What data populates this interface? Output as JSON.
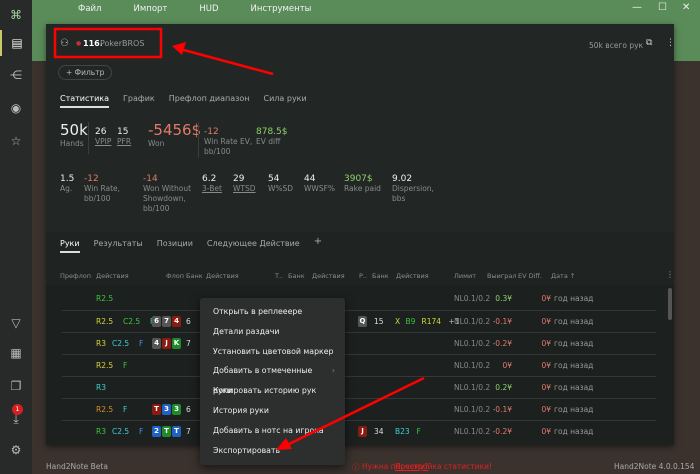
{
  "app": {
    "name": "Hand2Note Beta",
    "version": "Hand2Note 4.0.0.154"
  },
  "menu": [
    "Файл",
    "Импорт",
    "HUD",
    "Инструменты"
  ],
  "player": {
    "rank": "116.",
    "name": "PokerBROS",
    "total_hands": "50k всего рук"
  },
  "filter_label": "+ Фильтр",
  "stat_tabs": [
    "Статистика",
    "График",
    "Префлоп диапазон",
    "Сила руки"
  ],
  "stats_row1": [
    {
      "value": "50k",
      "label": "Hands"
    },
    {
      "value": "26",
      "label": "VPIP"
    },
    {
      "value": "15",
      "label": "PFR"
    },
    {
      "value": "-5456$",
      "label": "Won"
    },
    {
      "value": "-12",
      "label": "Win Rate EV, bb/100"
    },
    {
      "value": "878.5$",
      "label": "EV diff"
    }
  ],
  "stats_row2": [
    {
      "value": "1.5",
      "label": "Ag."
    },
    {
      "value": "-12",
      "label": "Win Rate, bb/100"
    },
    {
      "value": "-14",
      "label": "Won Without Showdown, bb/100"
    },
    {
      "value": "6.2",
      "label": "3-Bet"
    },
    {
      "value": "29",
      "label": "WTSD"
    },
    {
      "value": "54",
      "label": "W%SD"
    },
    {
      "value": "44",
      "label": "WWSF%"
    },
    {
      "value": "3907$",
      "label": "Rake paid"
    },
    {
      "value": "9.02",
      "label": "Dispersion, bbs"
    }
  ],
  "hand_tabs": [
    "Руки",
    "Результаты",
    "Позиции",
    "Следующее Действие",
    "+"
  ],
  "columns": [
    "Префлоп",
    "Действия",
    "Флоп",
    "Банк",
    "Действия",
    "Т..",
    "Банк",
    "Действия",
    "Р..",
    "Банк",
    "Действия",
    "Лимит",
    "Выиграл",
    "EV Diff.",
    "Дата ↑"
  ],
  "rows": [
    {
      "pre": [
        [
          "R2.5",
          "#3ec43e"
        ]
      ],
      "flop": [],
      "fpot": "",
      "river": "",
      "rpot": "",
      "ract": [],
      "limit": "NL0.1/0.2",
      "won": "0.3¥",
      "wonc": "#8fd16a",
      "ev": "0¥",
      "date": "год назад"
    },
    {
      "pre": [
        [
          "R2.5",
          "#d4d43a"
        ],
        [
          "C2.5",
          "#3ec43e"
        ],
        [
          "F",
          "#3fd0d0"
        ]
      ],
      "flop": [
        [
          "6",
          "#555"
        ],
        [
          "7",
          "#555"
        ],
        [
          "4",
          "#8b1a10"
        ]
      ],
      "fpot": "6",
      "river": "Q",
      "rpot": "15",
      "ract": [
        [
          "X",
          "#d4d43a"
        ],
        [
          "B9",
          "#3ec43e"
        ],
        [
          "R174",
          "#d4d43a"
        ],
        [
          "+1",
          "#bbb"
        ]
      ],
      "limit": "NL0.1/0.2",
      "won": "-0.1¥",
      "wonc": "#e07a6a",
      "ev": "0¥",
      "date": "год назад"
    },
    {
      "pre": [
        [
          "R3",
          "#d4d43a"
        ],
        [
          "C2.5",
          "#3fd0d0"
        ],
        [
          "F",
          "#4a8ef0"
        ]
      ],
      "flop": [
        [
          "4",
          "#555"
        ],
        [
          "J",
          "#8b1a10"
        ],
        [
          "K",
          "#1f8a2a"
        ]
      ],
      "fpot": "7",
      "river": "",
      "rpot": "",
      "ract": [],
      "limit": "NL0.1/0.2",
      "won": "-0.2¥",
      "wonc": "#e07a6a",
      "ev": "0¥",
      "date": "год назад"
    },
    {
      "pre": [
        [
          "R2.5",
          "#d4d43a"
        ],
        [
          "F",
          "#3ec43e"
        ]
      ],
      "flop": [],
      "fpot": "",
      "river": "",
      "rpot": "",
      "ract": [],
      "limit": "NL0.1/0.2",
      "won": "0¥",
      "wonc": "#e07a6a",
      "ev": "0¥",
      "date": "год назад"
    },
    {
      "pre": [
        [
          "R3",
          "#3fd0d0"
        ]
      ],
      "flop": [],
      "fpot": "",
      "river": "",
      "rpot": "",
      "ract": [],
      "limit": "NL0.1/0.2",
      "won": "0.2¥",
      "wonc": "#8fd16a",
      "ev": "0¥",
      "date": "год назад"
    },
    {
      "pre": [
        [
          "R2.5",
          "#d4902a"
        ],
        [
          "F",
          "#3fd0d0"
        ]
      ],
      "flop": [
        [
          "T",
          "#8b1a10"
        ],
        [
          "3",
          "#1f62c4"
        ],
        [
          "3",
          "#1f8a2a"
        ]
      ],
      "fpot": "6",
      "river": "",
      "rpot": "",
      "ract": [],
      "limit": "NL0.1/0.2",
      "won": "-0.1¥",
      "wonc": "#e07a6a",
      "ev": "0¥",
      "date": "год назад"
    },
    {
      "pre": [
        [
          "R3",
          "#3ec43e"
        ],
        [
          "C2.5",
          "#3fd0d0"
        ],
        [
          "F",
          "#4a8ef0"
        ]
      ],
      "flop": [
        [
          "2",
          "#1f62c4"
        ],
        [
          "T",
          "#1f8a2a"
        ],
        [
          "T",
          "#1f62c4"
        ]
      ],
      "fpot": "7",
      "river": "J",
      "rpot": "34",
      "ract": [
        [
          "B23",
          "#3fd0d0"
        ],
        [
          "F",
          "#3ec43e"
        ]
      ],
      "limit": "NL0.1/0.2",
      "won": "-0.2¥",
      "wonc": "#e07a6a",
      "ev": "0¥",
      "date": "год назад"
    }
  ],
  "context_menu": [
    "Открыть в реплееере",
    "Детали раздачи",
    "Установить цветовой маркер",
    "Добавить в отмеченные руки",
    "Копировать историю рук",
    "История руки",
    "Добавить в нотс на игрока",
    "Экспортировать"
  ],
  "footer": {
    "warning": "Нужна перестройка статистики!",
    "link": "Почему?"
  },
  "notification_badge": "1",
  "colors": {
    "accent": "#5a8c5a",
    "annotation": "#ff0000"
  }
}
